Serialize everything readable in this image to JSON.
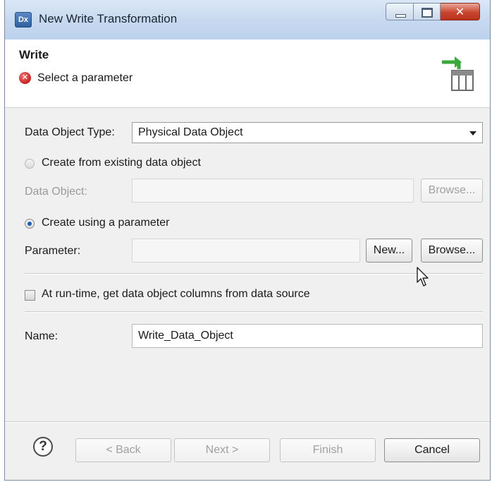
{
  "window": {
    "title": "New Write Transformation",
    "app_icon_text": "Dx"
  },
  "header": {
    "section_title": "Write",
    "error_message": "Select a parameter",
    "banner_icon": "write-target-icon"
  },
  "form": {
    "data_object_type_label": "Data Object Type:",
    "data_object_type_value": "Physical Data Object",
    "radio_existing_label": "Create from existing data object",
    "radio_existing_selected": false,
    "data_object_label": "Data Object:",
    "data_object_value": "",
    "browse_label": "Browse...",
    "radio_parameter_label": "Create using a parameter",
    "radio_parameter_selected": true,
    "parameter_label": "Parameter:",
    "parameter_value": "",
    "new_label": "New...",
    "parameter_browse_label": "Browse...",
    "runtime_checkbox_label": "At run-time, get data object columns from data source",
    "runtime_checked": false,
    "name_label": "Name:",
    "name_value": "Write_Data_Object"
  },
  "footer": {
    "help_symbol": "?",
    "back_label": "< Back",
    "next_label": "Next >",
    "finish_label": "Finish",
    "cancel_label": "Cancel"
  },
  "colors": {
    "titlebar": "#c5d8ef",
    "error": "#c81e1e",
    "arrow_green": "#3aa83a",
    "radio_selected": "#1f5fb0"
  }
}
